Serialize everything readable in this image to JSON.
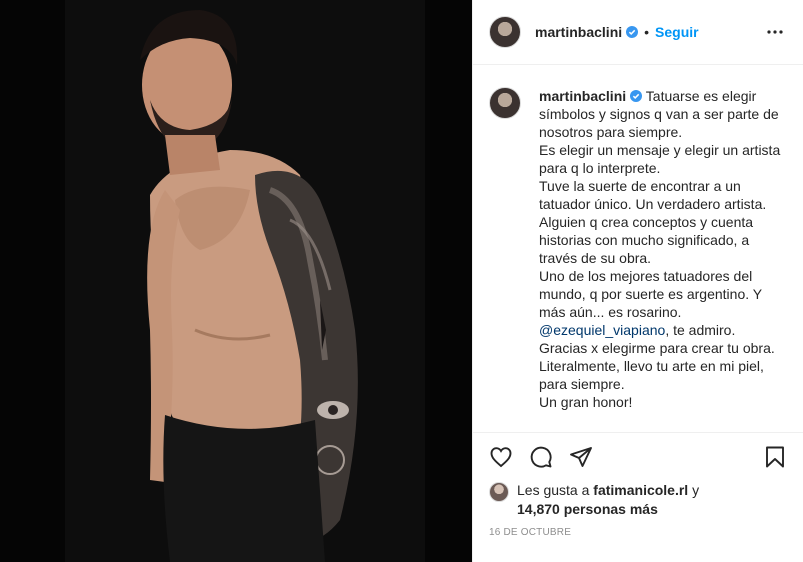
{
  "post": {
    "author": "martinbaclini",
    "follow_label": "Seguir",
    "dot": "•",
    "caption_lines": [
      "Tatuarse es elegir",
      "símbolos y signos q van a ser parte de",
      "nosotros para siempre.",
      "Es elegir un mensaje y elegir un artista",
      "para q lo interprete.",
      "Tuve la suerte de encontrar a un",
      "tatuador único. Un verdadero artista.",
      "Alguien q crea conceptos y cuenta",
      "historias con mucho significado, a",
      "través de su obra.",
      "Uno de los mejores tatuadores del",
      "mundo, q por suerte es argentino. Y",
      "más aún... es rosarino."
    ],
    "mention": "@ezequiel_viapiano",
    "mention_suffix": ", te admiro.",
    "caption_tail": [
      "Gracias x elegirme para crear tu obra.",
      "Literalmente, llevo tu arte en mi piel,",
      "para siempre.",
      "Un gran honor!"
    ],
    "likes_prefix": "Les gusta a ",
    "liker": "fatimanicole.rl",
    "likes_and": " y",
    "likes_count": "14,870 personas más",
    "date": "16 DE OCTUBRE"
  },
  "colors": {
    "accent": "#0095f6",
    "verified": "#3897f0",
    "mention": "#00376b",
    "muted": "#8e8e8e"
  },
  "icons": {
    "more": "more-options-icon",
    "like": "heart-icon",
    "comment": "comment-bubble-icon",
    "share": "paper-plane-icon",
    "save": "bookmark-icon",
    "verified": "verified-badge-icon"
  }
}
